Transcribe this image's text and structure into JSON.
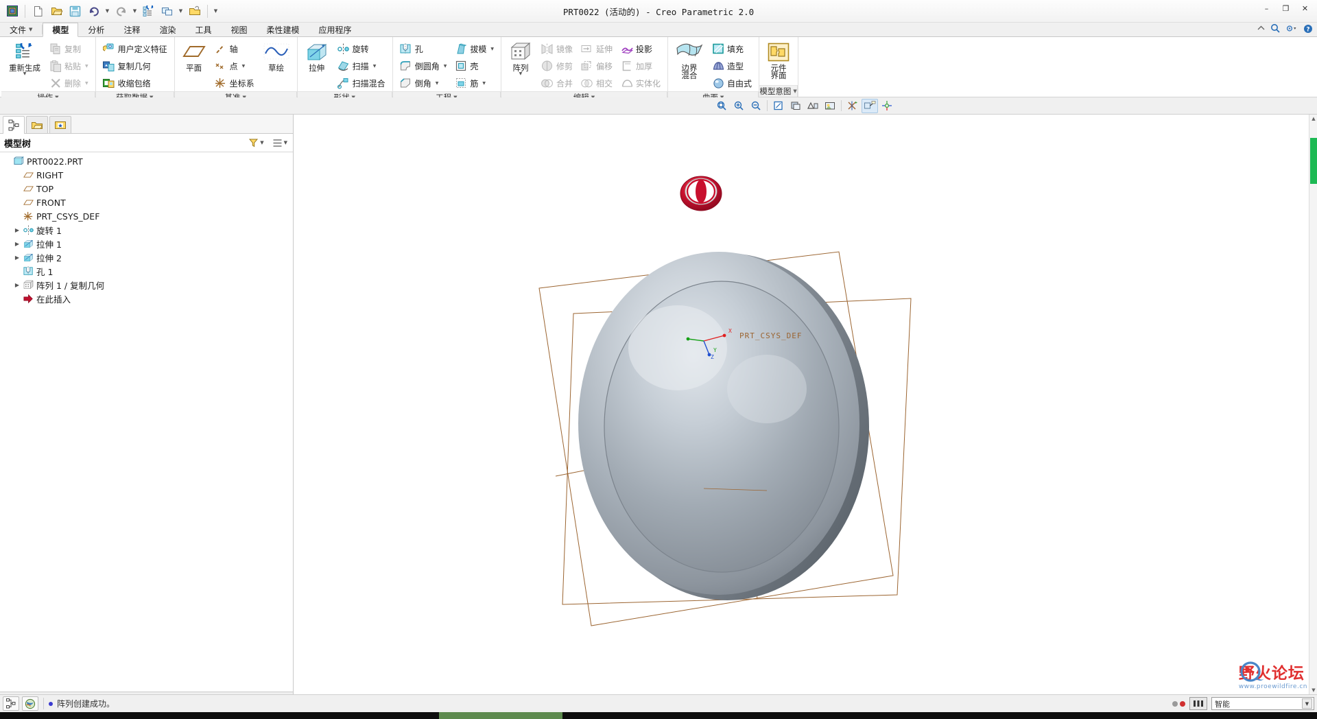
{
  "window": {
    "title": "PRT0022 (活动的) - Creo Parametric 2.0",
    "minimize": "–",
    "maximize": "❐",
    "close": "✕"
  },
  "quick_access": [
    {
      "name": "creo-home-icon",
      "tip": "Creo"
    },
    {
      "name": "new-icon",
      "tip": "新建"
    },
    {
      "name": "open-icon",
      "tip": "打开"
    },
    {
      "name": "save-icon",
      "tip": "保存"
    },
    {
      "name": "undo-icon",
      "tip": "撤消"
    },
    {
      "name": "redo-icon",
      "tip": "重做"
    },
    {
      "name": "regenerate-icon",
      "tip": "重新生成"
    },
    {
      "name": "window-icon",
      "tip": "窗口"
    },
    {
      "name": "close-window-icon",
      "tip": "关闭"
    }
  ],
  "tabs": [
    {
      "label": "文件",
      "has_caret": true,
      "active": false
    },
    {
      "label": "模型",
      "has_caret": false,
      "active": true
    },
    {
      "label": "分析",
      "has_caret": false,
      "active": false
    },
    {
      "label": "注释",
      "has_caret": false,
      "active": false
    },
    {
      "label": "渲染",
      "has_caret": false,
      "active": false
    },
    {
      "label": "工具",
      "has_caret": false,
      "active": false
    },
    {
      "label": "视图",
      "has_caret": false,
      "active": false
    },
    {
      "label": "柔性建模",
      "has_caret": false,
      "active": false
    },
    {
      "label": "应用程序",
      "has_caret": false,
      "active": false
    }
  ],
  "ribbon_right": [
    {
      "name": "minimize-ribbon-icon"
    },
    {
      "name": "search-icon"
    },
    {
      "name": "settings-icon"
    },
    {
      "name": "help-icon"
    }
  ],
  "ribbon_groups": [
    {
      "label": "操作",
      "big": {
        "label": "重新生成",
        "icon": "regenerate-icon",
        "caret": true
      },
      "items": [
        {
          "label": "复制",
          "icon": "copy-icon",
          "disabled": true,
          "caret": false
        },
        {
          "label": "粘贴",
          "icon": "paste-icon",
          "disabled": true,
          "caret": true
        },
        {
          "label": "删除",
          "icon": "delete-icon",
          "disabled": true,
          "caret": true
        }
      ]
    },
    {
      "label": "获取数据",
      "items": [
        {
          "label": "用户定义特征",
          "icon": "udf-icon",
          "disabled": false,
          "caret": false
        },
        {
          "label": "复制几何",
          "icon": "copy-geom-icon",
          "disabled": false,
          "caret": false
        },
        {
          "label": "收缩包络",
          "icon": "shrinkwrap-icon",
          "disabled": false,
          "caret": false
        }
      ]
    },
    {
      "label": "基准",
      "big": {
        "label": "平面",
        "icon": "plane-icon",
        "caret": false
      },
      "items": [
        {
          "label": "轴",
          "icon": "axis-icon",
          "disabled": false,
          "caret": false
        },
        {
          "label": "点",
          "icon": "point-icon",
          "disabled": false,
          "caret": true
        },
        {
          "label": "坐标系",
          "icon": "csys-icon",
          "disabled": false,
          "caret": false
        }
      ],
      "big2": {
        "label": "草绘",
        "icon": "sketch-icon",
        "caret": false
      }
    },
    {
      "label": "形状",
      "big": {
        "label": "拉伸",
        "icon": "extrude-icon",
        "caret": false
      },
      "items": [
        {
          "label": "旋转",
          "icon": "revolve-icon",
          "disabled": false,
          "caret": false
        },
        {
          "label": "扫描",
          "icon": "sweep-icon",
          "disabled": false,
          "caret": true
        },
        {
          "label": "扫描混合",
          "icon": "sweepblend-icon",
          "disabled": false,
          "caret": false
        }
      ]
    },
    {
      "label": "工程",
      "items": [
        {
          "label": "孔",
          "icon": "hole-icon",
          "disabled": false,
          "caret": false
        },
        {
          "label": "倒圆角",
          "icon": "round-icon",
          "disabled": false,
          "caret": true
        },
        {
          "label": "倒角",
          "icon": "chamfer-icon",
          "disabled": false,
          "caret": true
        }
      ],
      "items2": [
        {
          "label": "拔模",
          "icon": "draft-icon",
          "disabled": false,
          "caret": true
        },
        {
          "label": "壳",
          "icon": "shell-icon",
          "disabled": false,
          "caret": false
        },
        {
          "label": "筋",
          "icon": "rib-icon",
          "disabled": false,
          "caret": true
        }
      ]
    },
    {
      "label": "编辑",
      "big": {
        "label": "阵列",
        "icon": "pattern-icon",
        "caret": true
      },
      "items": [
        {
          "label": "镜像",
          "icon": "mirror-icon",
          "disabled": true,
          "caret": false
        },
        {
          "label": "修剪",
          "icon": "trim-icon",
          "disabled": true,
          "caret": false
        },
        {
          "label": "合并",
          "icon": "merge-icon",
          "disabled": true,
          "caret": false
        }
      ],
      "items2": [
        {
          "label": "延伸",
          "icon": "extend-icon",
          "disabled": true,
          "caret": false
        },
        {
          "label": "偏移",
          "icon": "offset-icon",
          "disabled": true,
          "caret": false
        },
        {
          "label": "相交",
          "icon": "intersect-icon",
          "disabled": true,
          "caret": false
        }
      ],
      "items3": [
        {
          "label": "投影",
          "icon": "project-icon",
          "disabled": false,
          "caret": false
        },
        {
          "label": "加厚",
          "icon": "thicken-icon",
          "disabled": true,
          "caret": false
        },
        {
          "label": "实体化",
          "icon": "solidify-icon",
          "disabled": true,
          "caret": false
        }
      ]
    },
    {
      "label": "曲面",
      "big": {
        "label": "边界",
        "label2": "混合",
        "icon": "boundary-blend-icon",
        "caret": false
      },
      "items": [
        {
          "label": "填充",
          "icon": "fill-icon",
          "disabled": false,
          "caret": false
        },
        {
          "label": "造型",
          "icon": "style-icon",
          "disabled": false,
          "caret": false
        },
        {
          "label": "自由式",
          "icon": "freestyle-icon",
          "disabled": false,
          "caret": false
        }
      ]
    },
    {
      "label": "模型意图",
      "big": {
        "label": "元件",
        "label2": "界面",
        "icon": "component-interface-icon",
        "caret": false
      }
    }
  ],
  "view_toolbar": [
    {
      "name": "refit-icon",
      "active": false
    },
    {
      "name": "zoom-in-icon",
      "active": false
    },
    {
      "name": "zoom-out-icon",
      "active": false
    },
    {
      "name": "repaint-icon",
      "active": false
    },
    {
      "name": "display-style-icon",
      "active": false
    },
    {
      "name": "saved-views-icon",
      "active": false
    },
    {
      "name": "scene-icon",
      "active": false
    },
    {
      "name": "datum-display-icon",
      "active": false
    },
    {
      "name": "annotation-display-icon",
      "active": true
    },
    {
      "name": "spin-center-icon",
      "active": false
    }
  ],
  "navigator": {
    "tabs": [
      {
        "name": "model-tree-tab",
        "active": true
      },
      {
        "name": "folder-tab",
        "active": false
      },
      {
        "name": "favorites-tab",
        "active": false
      }
    ],
    "title": "模型树",
    "header_buttons": [
      {
        "name": "tree-filters-icon",
        "caret": true
      },
      {
        "name": "tree-settings-icon",
        "caret": true
      }
    ],
    "tree": [
      {
        "label": "PRT0022.PRT",
        "icon": "part-icon",
        "indent": 0,
        "expander": "none"
      },
      {
        "label": "RIGHT",
        "icon": "plane-icon",
        "indent": 1,
        "expander": "none"
      },
      {
        "label": "TOP",
        "icon": "plane-icon",
        "indent": 1,
        "expander": "none"
      },
      {
        "label": "FRONT",
        "icon": "plane-icon",
        "indent": 1,
        "expander": "none"
      },
      {
        "label": "PRT_CSYS_DEF",
        "icon": "csys-icon",
        "indent": 1,
        "expander": "none"
      },
      {
        "label": "旋转 1",
        "icon": "revolve-icon",
        "indent": 1,
        "expander": "collapsed"
      },
      {
        "label": "拉伸 1",
        "icon": "extrude-icon",
        "indent": 1,
        "expander": "collapsed"
      },
      {
        "label": "拉伸 2",
        "icon": "extrude-icon",
        "indent": 1,
        "expander": "collapsed"
      },
      {
        "label": "孔 1",
        "icon": "hole-icon",
        "indent": 1,
        "expander": "none"
      },
      {
        "label": "阵列 1 / 复制几何",
        "icon": "pattern-icon",
        "indent": 1,
        "expander": "collapsed"
      },
      {
        "label": "在此插入",
        "icon": "insert-here-icon",
        "indent": 1,
        "expander": "none"
      }
    ]
  },
  "graphics": {
    "csys_label": "PRT_CSYS_DEF",
    "axis_x_label": "X",
    "axis_y_label": "Y",
    "axis_z_label": "Z",
    "colors": {
      "sphere_light": "#d8dde3",
      "sphere_mid": "#9aa3ad",
      "sphere_dark": "#6c757f",
      "sphere_rim": "#5b636c",
      "hole_red": "#c8102e",
      "sketch_brown": "#9b6430",
      "csys_red": "#e02020",
      "csys_green": "#15a015",
      "csys_blue": "#2050d0",
      "background": "#ffffff"
    }
  },
  "scrollbar": {
    "thumb_color": "#1db954",
    "thumb_top_pct": 4,
    "thumb_height_pct": 8
  },
  "watermark": {
    "text": "野火论坛",
    "sub": "www.proewildfire.cn"
  },
  "status": {
    "left_buttons": [
      {
        "name": "model-tree-toggle-icon"
      },
      {
        "name": "browser-toggle-icon"
      }
    ],
    "message": "阵列创建成功。",
    "right": {
      "led_red": "#d03030",
      "led_gray": "#9a9a9a",
      "selection_icon": "selection-filter-icon",
      "smart_label": "智能"
    }
  }
}
